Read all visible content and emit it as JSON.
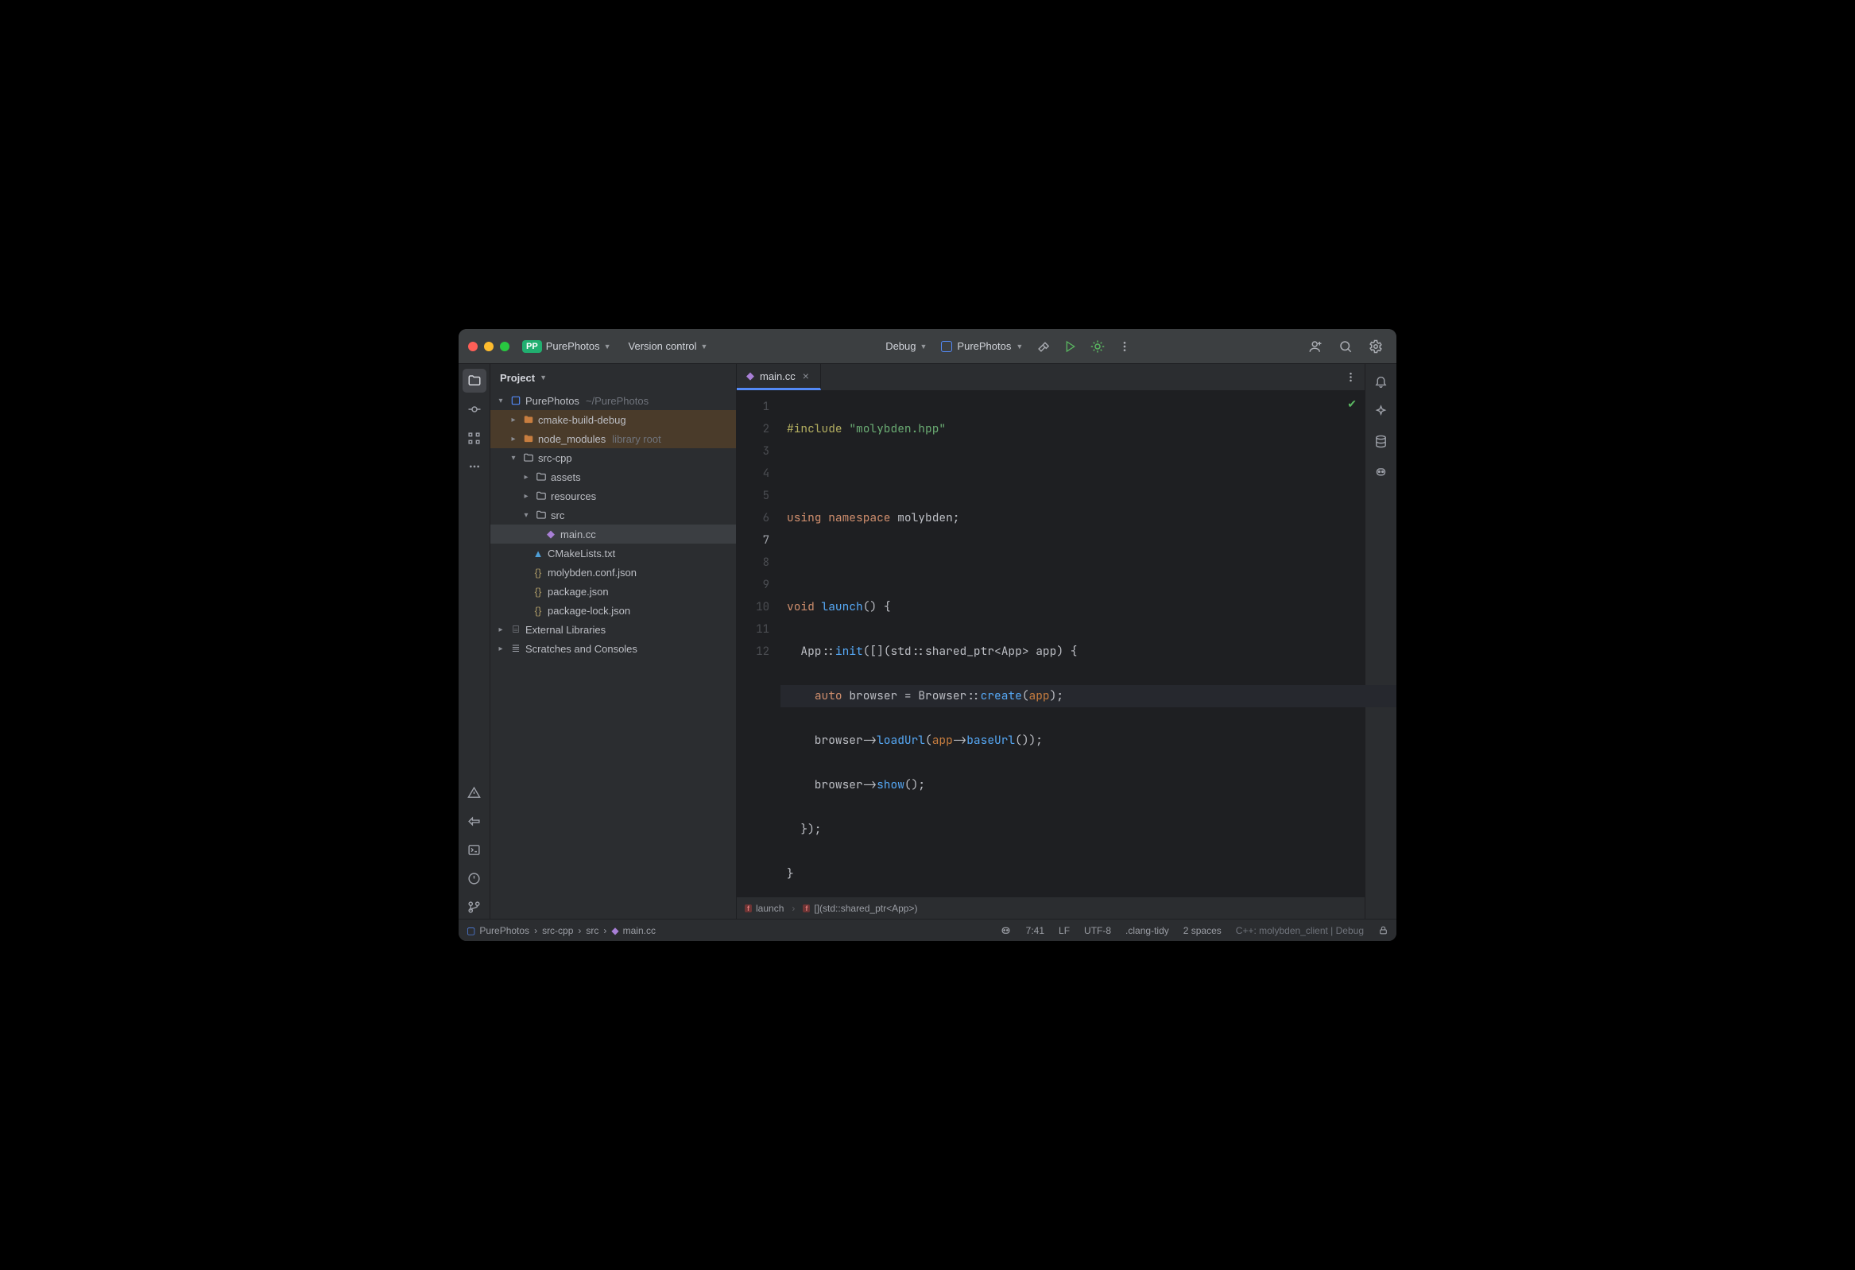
{
  "titlebar": {
    "project_badge": "PP",
    "project_name": "PurePhotos",
    "vcs_label": "Version control",
    "debug_label": "Debug",
    "run_config": "PurePhotos"
  },
  "panel": {
    "header": "Project"
  },
  "tree": {
    "root": {
      "name": "PurePhotos",
      "path": "~/PurePhotos"
    },
    "cmake": "cmake-build-debug",
    "node_modules": {
      "name": "node_modules",
      "note": "library root"
    },
    "src_cpp": "src-cpp",
    "assets": "assets",
    "resources": "resources",
    "src": "src",
    "main_cc": "main.cc",
    "cmakelists": "CMakeLists.txt",
    "conf_json": "molybden.conf.json",
    "pkg_json": "package.json",
    "pkg_lock": "package-lock.json",
    "ext_lib": "External Libraries",
    "scratches": "Scratches and Consoles"
  },
  "tab": {
    "filename": "main.cc"
  },
  "code_lines": [
    "1",
    "2",
    "3",
    "4",
    "5",
    "6",
    "7",
    "8",
    "9",
    "10",
    "11",
    "12"
  ],
  "code": {
    "l1a": "#include",
    "l1b": "\"molybden.hpp\"",
    "l3a": "using namespace",
    "l3b": "molybden;",
    "l5a": "void",
    "l5b": "launch",
    "l5c": "() {",
    "l6a": "  App::",
    "l6b": "init",
    "l6c": "([](std::shared_ptr<App> app) {",
    "l7a": "    ",
    "l7b": "auto",
    "l7c": " browser = Browser::",
    "l7d": "create",
    "l7e": "(",
    "l7f": "app",
    "l7g": ");",
    "l8a": "    browser->",
    "l8b": "loadUrl",
    "l8c": "(",
    "l8d": "app",
    "l8e": "->",
    "l8f": "baseUrl",
    "l8g": "());",
    "l9a": "    browser->",
    "l9b": "show",
    "l9c": "();",
    "l10": "  });",
    "l11": "}"
  },
  "crumbs": {
    "fn_badge": "f",
    "launch": "launch",
    "lambda": "[](std::shared_ptr<App>)"
  },
  "status": {
    "bc1": "PurePhotos",
    "bc2": "src-cpp",
    "bc3": "src",
    "bc4": "main.cc",
    "pos": "7:41",
    "line_sep": "LF",
    "encoding": "UTF-8",
    "linter": ".clang-tidy",
    "indent": "2 spaces",
    "cfg": "C++: molybden_client | Debug"
  }
}
